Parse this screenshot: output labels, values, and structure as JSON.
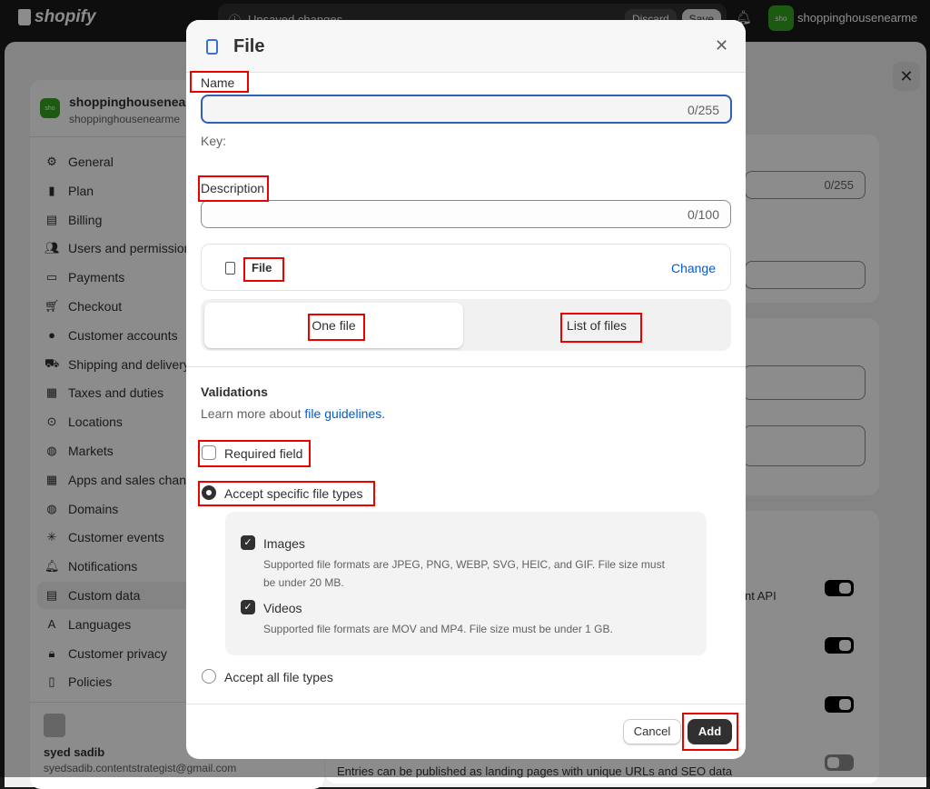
{
  "topbar": {
    "brand": "shopify",
    "unsaved": "Unsaved changes",
    "discard": "Discard",
    "save": "Save",
    "store_initials": "sho",
    "store_name": "shoppinghousenearme"
  },
  "sidebar": {
    "store_title": "shoppinghousenearme",
    "store_domain": "shoppinghousenearme",
    "store_initials": "sho",
    "items": [
      {
        "label": "General",
        "icon": "gear"
      },
      {
        "label": "Plan",
        "icon": "chart"
      },
      {
        "label": "Billing",
        "icon": "receipt"
      },
      {
        "label": "Users and permissions",
        "icon": "users"
      },
      {
        "label": "Payments",
        "icon": "payments"
      },
      {
        "label": "Checkout",
        "icon": "cart"
      },
      {
        "label": "Customer accounts",
        "icon": "person"
      },
      {
        "label": "Shipping and delivery",
        "icon": "truck"
      },
      {
        "label": "Taxes and duties",
        "icon": "tax"
      },
      {
        "label": "Locations",
        "icon": "pin"
      },
      {
        "label": "Markets",
        "icon": "globe"
      },
      {
        "label": "Apps and sales channels",
        "icon": "apps"
      },
      {
        "label": "Domains",
        "icon": "globe"
      },
      {
        "label": "Customer events",
        "icon": "sparkle"
      },
      {
        "label": "Notifications",
        "icon": "bell"
      },
      {
        "label": "Custom data",
        "icon": "database",
        "selected": true
      },
      {
        "label": "Languages",
        "icon": "language"
      },
      {
        "label": "Customer privacy",
        "icon": "lock"
      },
      {
        "label": "Policies",
        "icon": "document"
      }
    ],
    "user_name": "syed sadib",
    "user_email": "syedsadib.contentstrategist@gmail.com"
  },
  "background": {
    "counter": "0/255",
    "api_text": "nt API",
    "entries_text": "Entries can be published as landing pages with unique URLs and SEO data",
    "toggles": [
      true,
      true,
      true,
      false
    ]
  },
  "modal": {
    "title": "File",
    "name_label": "Name",
    "name_value": "",
    "name_counter": "0/255",
    "key_label": "Key:",
    "description_label": "Description",
    "description_counter": "0/100",
    "type_label": "File",
    "change_link": "Change",
    "segments": [
      "One file",
      "List of files"
    ],
    "selected_segment": "One file",
    "validations_title": "Validations",
    "learn_more": "Learn more about",
    "learn_link": "file guidelines.",
    "required_label": "Required field",
    "required_checked": false,
    "accept_specific": "Accept specific file types",
    "accept_specific_selected": true,
    "images_label": "Images",
    "images_checked": true,
    "images_desc_1": "Supported file formats are JPEG, PNG, WEBP, SVG, HEIC, and GIF. File size must",
    "images_desc_2": "be under 20 MB.",
    "videos_label": "Videos",
    "videos_checked": true,
    "videos_desc": "Supported file formats are MOV and MP4. File size must be under 1 GB.",
    "accept_all": "Accept all file types",
    "cancel": "Cancel",
    "add": "Add"
  },
  "colors": {
    "accent": "#005bd3",
    "annotation": "#ee0000",
    "primary_button": "#303030"
  }
}
